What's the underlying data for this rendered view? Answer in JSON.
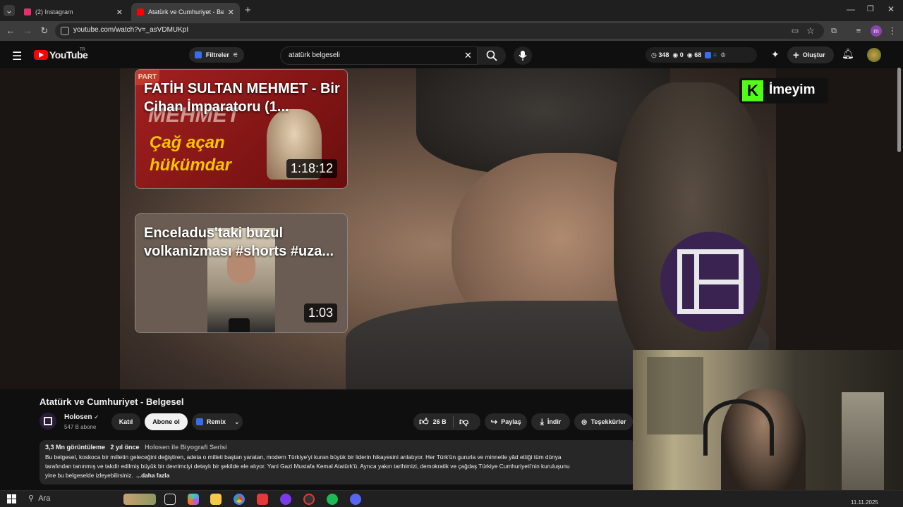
{
  "browser": {
    "tabs": [
      {
        "title": "(2) Instagram",
        "favicon_color": "#e1306c"
      },
      {
        "title": "Atatürk ve Cumhuriyet - Belgesel",
        "favicon_color": "#ff0000"
      }
    ],
    "url": "youtube.com/watch?v=_asVDMUKpI",
    "profile_initial": "m"
  },
  "youtube": {
    "logo_text": "YouTube",
    "region": "TR",
    "filter_label": "Filtreler",
    "search_value": "atatürk belgeseli",
    "stats": {
      "views": "348",
      "a": "0",
      "b": "68"
    },
    "create_label": "Oluştur"
  },
  "player": {
    "watermark": "İmeyim",
    "cards": [
      {
        "title": "FATİH SULTAN MEHMET - Bir Cihan İmparatoru (1...",
        "duration": "1:18:12",
        "thumb_text_1": "MEHMET",
        "thumb_text_2": "Çağ açan",
        "thumb_text_3": "hükümdar",
        "badge": "PART"
      },
      {
        "title": "Enceladus'taki buzul volkanizması #shorts #uza...",
        "duration": "1:03"
      }
    ]
  },
  "video": {
    "title": "Atatürk ve Cumhuriyet - Belgesel",
    "channel": "Holosen",
    "subscribers": "547 B abone",
    "join_label": "Katıl",
    "subscribe_label": "Abone ol",
    "remix_label": "Remix",
    "likes": "26 B",
    "share_label": "Paylaş",
    "download_label": "İndir",
    "thanks_label": "Teşekkürler",
    "views_line": "3,3 Mn görüntüleme",
    "date": "2 yıl önce",
    "series": "Holosen ile Biyografi Serisi",
    "description_lines": [
      "Bu belgesel, koskoca bir milletin geleceğini değiştiren, adeta o milleti baştan yaratan, modern Türkiye'yi kuran büyük bir liderin hikayesini anlatıyor. Her Türk'ün gururla ve minnetle yâd ettiği tüm dünya",
      "tarafından tanınmış ve takdir edilmiş büyük bir devrimciyi detaylı bir şekilde ele alıyor. Yani Gazi Mustafa Kemal Atatürk'ü. Ayrıca yakın tarihimizi, demokratik ve çağdaş Türkiye Cumhuriyeti'nin kuruluşunu",
      "yine bu belgeselde izleyebilirsiniz."
    ],
    "more_label": "...daha fazla"
  },
  "taskbar": {
    "search_label": "Ara",
    "clock": "11.11.2025"
  }
}
